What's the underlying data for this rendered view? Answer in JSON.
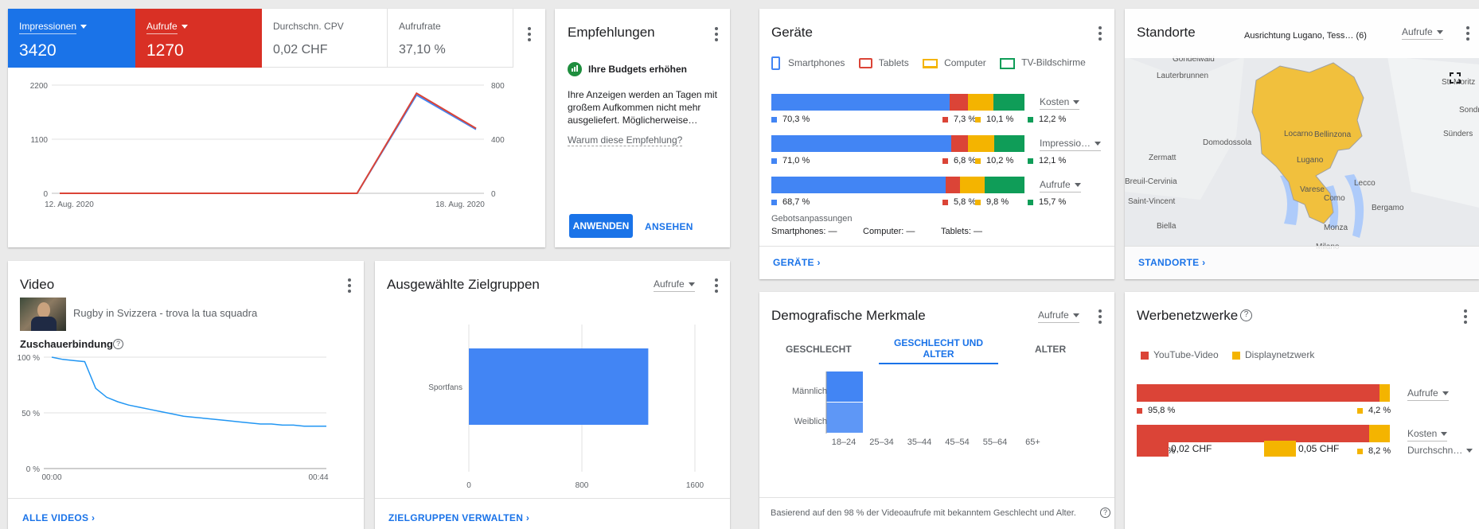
{
  "colors": {
    "blue": "#4285f4",
    "red": "#db4437",
    "yellow": "#f4b400",
    "green": "#0f9d58",
    "dark_blue": "#1a73e8",
    "map_yellow": "#f1c03d"
  },
  "overview": {
    "metrics": [
      {
        "label": "Impressionen",
        "value": "3420"
      },
      {
        "label": "Aufrufe",
        "value": "1270"
      },
      {
        "label": "Durchschn. CPV",
        "value": "0,02 CHF"
      },
      {
        "label": "Aufrufrate",
        "value": "37,10 %"
      }
    ],
    "chart_data": {
      "type": "line",
      "x_labels": [
        "12. Aug. 2020",
        "18. Aug. 2020"
      ],
      "y_left_ticks": [
        "2200",
        "1100",
        "0"
      ],
      "y_right_ticks": [
        "800",
        "400",
        "0"
      ],
      "ylim_left": [
        0,
        2200
      ],
      "ylim_right": [
        0,
        800
      ],
      "series": [
        {
          "name": "Impressionen",
          "axis": "left",
          "color": "#4285f4",
          "values": [
            0,
            0,
            0,
            0,
            0,
            0,
            2000,
            1300
          ]
        },
        {
          "name": "Aufrufe",
          "axis": "right",
          "color": "#db4437",
          "values": [
            0,
            0,
            0,
            0,
            0,
            0,
            740,
            480
          ]
        }
      ]
    }
  },
  "recommendations": {
    "title": "Empfehlungen",
    "item_title": "Ihre Budgets erhöhen",
    "body": "Ihre Anzeigen werden an Tagen mit großem Aufkommen nicht mehr ausgeliefert. Möglicherweise…",
    "why": "Warum diese Empfehlung?",
    "apply": "ANWENDEN",
    "view": "ANSEHEN"
  },
  "video": {
    "title": "Video",
    "video_name": "Rugby in Svizzera - trova la tua squadra",
    "retention_label": "Zuschauerbindung",
    "chart_data": {
      "type": "line",
      "y_ticks": [
        "100 %",
        "50 %",
        "0 %"
      ],
      "x_labels": [
        "00:00",
        "00:44"
      ],
      "ylim": [
        0,
        100
      ],
      "series": [
        {
          "name": "Zuschauerbindung",
          "values": [
            100,
            98,
            97,
            96,
            72,
            64,
            60,
            57,
            55,
            53,
            51,
            49,
            47,
            46,
            45,
            44,
            43,
            42,
            41,
            40,
            40,
            39,
            39,
            38,
            38,
            38
          ]
        }
      ]
    },
    "link": "ALLE VIDEOS"
  },
  "audiences": {
    "title": "Ausgewählte Zielgruppen",
    "dropdown": "Aufrufe",
    "chart_data": {
      "type": "bar",
      "orientation": "horizontal",
      "categories": [
        "Sportfans"
      ],
      "values": [
        1270
      ],
      "x_ticks": [
        "0",
        "800",
        "1600"
      ],
      "xlim": [
        0,
        1600
      ]
    },
    "link": "ZIELGRUPPEN VERWALTEN"
  },
  "devices": {
    "title": "Geräte",
    "legend": [
      "Smartphones",
      "Tablets",
      "Computer",
      "TV-Bildschirme"
    ],
    "rows": [
      {
        "dropdown": "Kosten",
        "values": [
          70.3,
          7.3,
          10.1,
          12.2
        ],
        "labels": [
          "70,3 %",
          "7,3 %",
          "10,1 %",
          "12,2 %"
        ]
      },
      {
        "dropdown": "Impressio…",
        "values": [
          71.0,
          6.8,
          10.2,
          12.1
        ],
        "labels": [
          "71,0 %",
          "6,8 %",
          "10,2 %",
          "12,1 %"
        ]
      },
      {
        "dropdown": "Aufrufe",
        "values": [
          68.7,
          5.8,
          9.8,
          15.7
        ],
        "labels": [
          "68,7 %",
          "5,8 %",
          "9,8 %",
          "15,7 %"
        ]
      }
    ],
    "bid_title": "Gebotsanpassungen",
    "bid_items": [
      "Smartphones: —",
      "Computer: —",
      "Tablets: —"
    ],
    "link": "GERÄTE"
  },
  "locations": {
    "title": "Standorte",
    "targeting": "Ausrichtung Lugano, Tess… (6)",
    "dropdown": "Aufrufe",
    "places": [
      "Gondelwald",
      "Lauterbrunnen",
      "St. Moritz",
      "Domodossola",
      "Locarno",
      "Bellinzona",
      "Sondrio",
      "Zermatt",
      "Lugano",
      "Breuil-Cervinia",
      "Varese",
      "Lecco",
      "Saint-Vincent",
      "Como",
      "Bergamo",
      "Sünders",
      "Monza",
      "Milano",
      "Biella"
    ],
    "link": "STANDORTE"
  },
  "demographics": {
    "title": "Demografische Merkmale",
    "dropdown": "Aufrufe",
    "tabs": [
      "GESCHLECHT",
      "GESCHLECHT UND ALTER",
      "ALTER"
    ],
    "rows": [
      "Männlich",
      "Weiblich"
    ],
    "ages": [
      "18–24",
      "25–34",
      "35–44",
      "45–54",
      "55–64",
      "65+"
    ],
    "note": "Basierend auf den 98 % der Videoaufrufe mit bekanntem Geschlecht und Alter."
  },
  "networks": {
    "title": "Werbenetzwerke",
    "legend": [
      "YouTube-Video",
      "Displaynetzwerk"
    ],
    "rows": [
      {
        "dropdown": "Aufrufe",
        "values": [
          95.8,
          4.2
        ],
        "labels": [
          "95,8 %",
          "4,2 %"
        ]
      },
      {
        "dropdown": "Kosten",
        "values": [
          91.8,
          8.2
        ],
        "labels": [
          "91,8 %",
          "8,2 %"
        ]
      }
    ],
    "cpv": [
      "0,02 CHF",
      "0,05 CHF"
    ],
    "cpv_dropdown": "Durchschn…"
  }
}
